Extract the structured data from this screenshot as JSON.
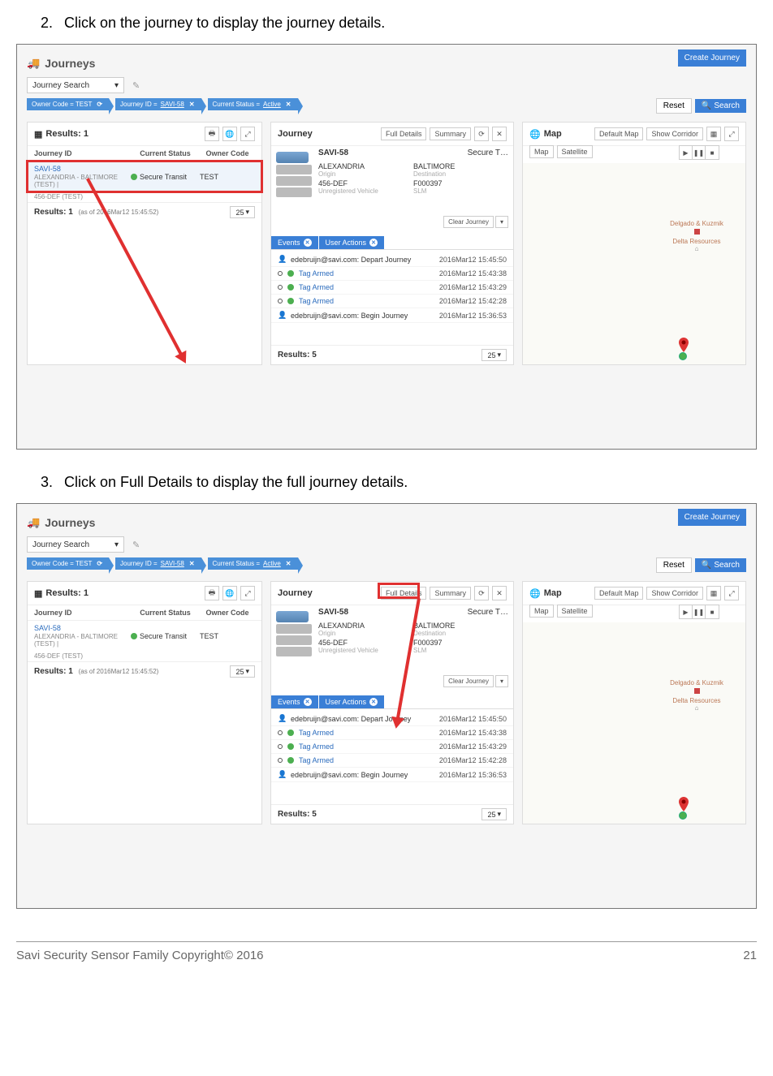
{
  "steps": {
    "s2_num": "2.",
    "s2_text": "Click on the journey to display the journey details.",
    "s3_num": "3.",
    "s3_text": "Click on Full Details to display the full journey details."
  },
  "ui": {
    "page_title": "Journeys",
    "create_journey": "Create Journey",
    "search": {
      "label": "Journey Search",
      "reset": "Reset",
      "search": "Search"
    },
    "filters": {
      "f1": "Owner Code = TEST",
      "f2_pre": "Journey ID = ",
      "f2_val": "SAVI-58",
      "f3_pre": "Current Status = ",
      "f3_val": "Active"
    },
    "results": {
      "title": "Results: 1",
      "col1": "Journey ID",
      "col2": "Current Status",
      "col3": "Owner Code",
      "row_id": "SAVI-58",
      "row_sub": "ALEXANDRIA - BALTIMORE (TEST)  |",
      "row_status": "Secure Transit",
      "row_owner": "TEST",
      "row2": "456-DEF (TEST)",
      "foot": "Results: 1",
      "foot_ts": "(as of 2016Mar12 15:45:52)",
      "pager": "25"
    },
    "journey": {
      "title": "Journey",
      "full_details": "Full Details",
      "summary": "Summary",
      "jid": "SAVI-58",
      "jstatus": "Secure T…",
      "origin_v": "ALEXANDRIA",
      "origin_l": "Origin",
      "dest_v": "BALTIMORE",
      "dest_l": "Destination",
      "veh_v": "456-DEF",
      "veh_l": "Unregistered Vehicle",
      "slm_v": "F000397",
      "slm_l": "SLM",
      "clear": "Clear Journey",
      "tab_events": "Events",
      "tab_actions": "User Actions",
      "events": [
        {
          "type": "user",
          "text": "edebruijn@savi.com: Depart Journey",
          "ts": "2016Mar12 15:45:50"
        },
        {
          "type": "tag",
          "text": "Tag Armed",
          "ts": "2016Mar12 15:43:38"
        },
        {
          "type": "tag",
          "text": "Tag Armed",
          "ts": "2016Mar12 15:43:29"
        },
        {
          "type": "tag",
          "text": "Tag Armed",
          "ts": "2016Mar12 15:42:28"
        },
        {
          "type": "user",
          "text": "edebruijn@savi.com: Begin Journey",
          "ts": "2016Mar12 15:36:53"
        }
      ],
      "ev_foot": "Results: 5",
      "ev_pager": "25"
    },
    "map": {
      "title": "Map",
      "default_map": "Default Map",
      "show_corridor": "Show Corridor",
      "map_btn": "Map",
      "sat_btn": "Satellite",
      "poi1": "Delgado & Kuzmik",
      "poi2": "Delta Resources"
    }
  },
  "footer": {
    "left": "Savi Security Sensor Family Copyright© 2016",
    "right": "21"
  }
}
